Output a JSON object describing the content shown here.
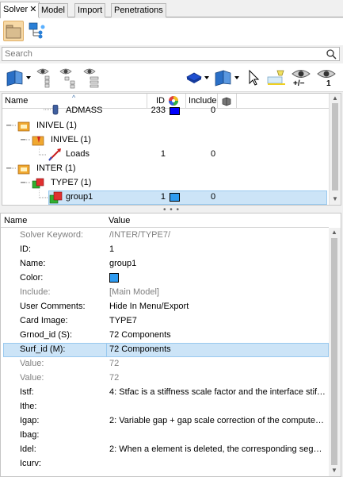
{
  "tabs": [
    {
      "label": "Solver",
      "active": true
    },
    {
      "label": "Model"
    },
    {
      "label": "Import"
    },
    {
      "label": "Penetrations"
    }
  ],
  "tab_close_glyph": "✕",
  "search": {
    "placeholder": "Search"
  },
  "toolbar1": {
    "icons": [
      "folder-icon",
      "hierarchy-icon"
    ]
  },
  "toolbar2": {
    "icons": [
      "component-view-icon",
      "tree-branch-eye-icon",
      "tree-eye-icon",
      "tree-list-eye-icon",
      "layer-icon",
      "display-icon",
      "select-cursor-icon",
      "highlight-icon",
      "show-toggle-icon",
      "show-one-icon"
    ],
    "eye_toggle_label": "+/−",
    "eye_one_label": "1"
  },
  "tree": {
    "columns": {
      "name": "Name",
      "id": "ID",
      "include": "Include"
    },
    "rows": [
      {
        "label": "ADMASS",
        "id": "233",
        "include": "0",
        "color": "#0000ff"
      },
      {
        "label": "INIVEL",
        "count": "(1)"
      },
      {
        "label": "INIVEL",
        "count": "(1)"
      },
      {
        "label": "Loads",
        "id": "1",
        "include": "0"
      },
      {
        "label": "INTER",
        "count": "(1)"
      },
      {
        "label": "TYPE7",
        "count": "(1)"
      },
      {
        "label": "group1",
        "id": "1",
        "include": "0",
        "color": "#2f9bf0"
      }
    ]
  },
  "properties": {
    "columns": {
      "name": "Name",
      "value": "Value"
    },
    "rows": [
      {
        "name": "Solver Keyword:",
        "value": "/INTER/TYPE7/",
        "grey": true
      },
      {
        "name": "ID:",
        "value": "1"
      },
      {
        "name": "Name:",
        "value": "group1"
      },
      {
        "name": "Color:",
        "value": "",
        "color": "#2f9bf0"
      },
      {
        "name": "Include:",
        "value": "[Main Model]",
        "grey": true
      },
      {
        "name": "User Comments:",
        "value": "Hide In Menu/Export"
      },
      {
        "name": "Card Image:",
        "value": "TYPE7"
      },
      {
        "name": "Grnod_id (S):",
        "value": "72 Components"
      },
      {
        "name": "Surf_id (M):",
        "value": "72 Components",
        "selected": true
      },
      {
        "name": "Value:",
        "value": "72",
        "grey": true
      },
      {
        "name": "Value:",
        "value": "72",
        "grey": true
      },
      {
        "name": "Istf:",
        "value": "4: Stfac is a stiffness scale factor and the interface stiffn..."
      },
      {
        "name": "Ithe:",
        "value": ""
      },
      {
        "name": "Igap:",
        "value": "2: Variable gap + gap scale correction of the computed g..."
      },
      {
        "name": "Ibag:",
        "value": ""
      },
      {
        "name": "Idel:",
        "value": "2: When a element is deleted, the corresponding segme..."
      },
      {
        "name": "Icurv:",
        "value": ""
      }
    ]
  },
  "colors": {
    "selection": "#cce4f7",
    "selection_border": "#99c9ef",
    "group_color": "#2f9bf0",
    "admass_color": "#0000ff"
  }
}
